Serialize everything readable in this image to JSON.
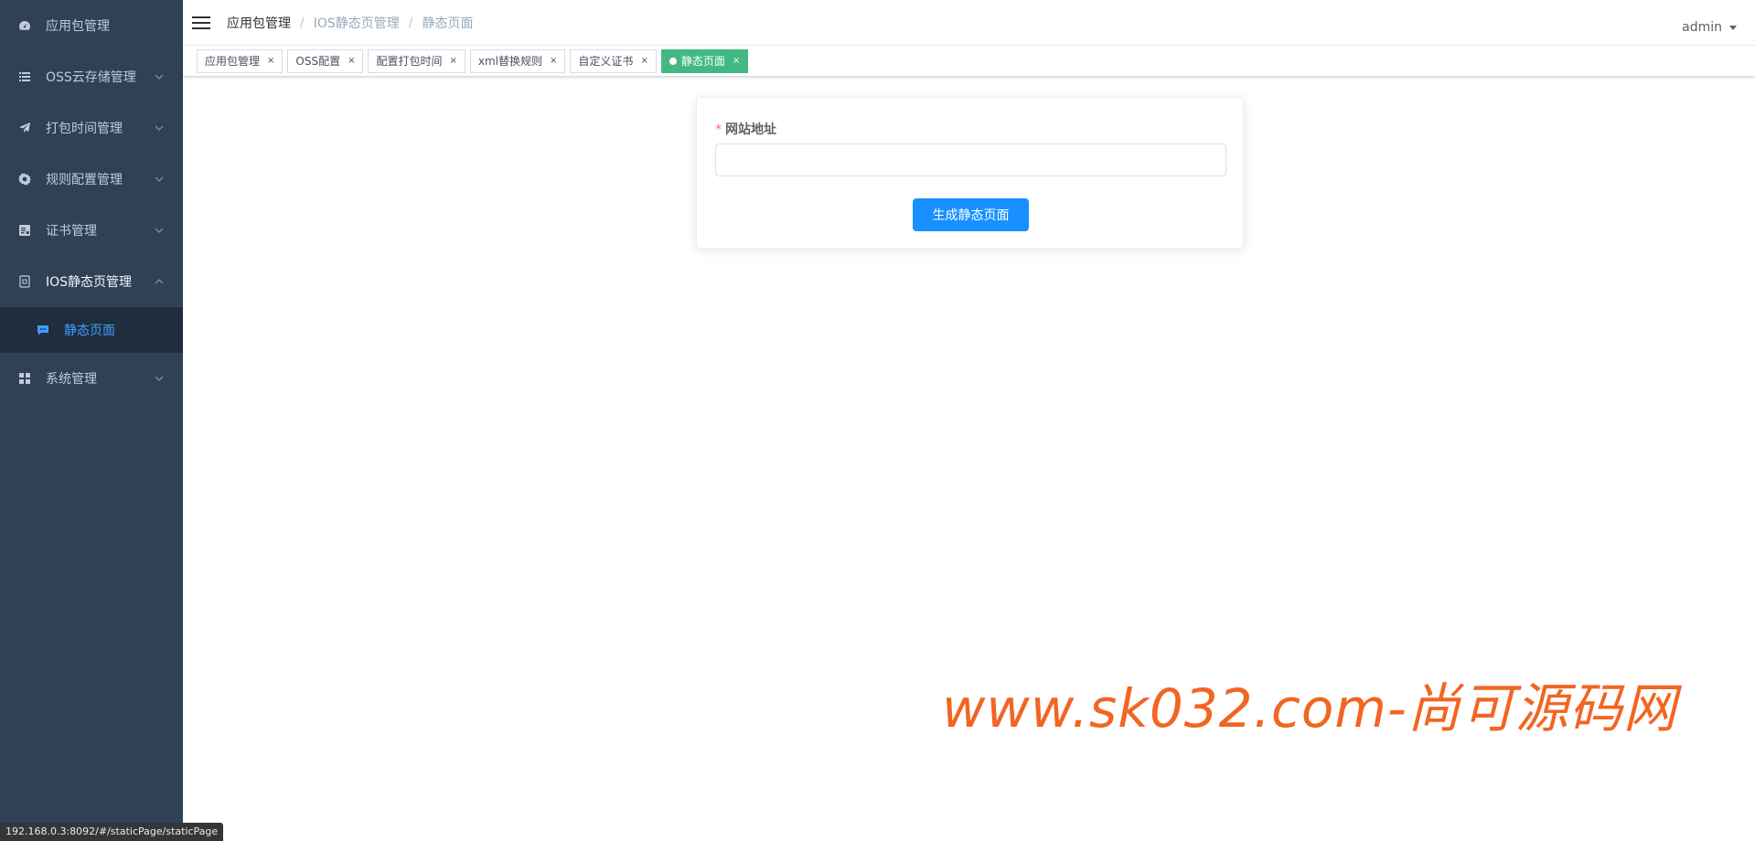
{
  "sidebar": {
    "items": [
      {
        "label": "应用包管理",
        "icon": "dashboard-icon"
      },
      {
        "label": "OSS云存储管理",
        "icon": "list-icon"
      },
      {
        "label": "打包时间管理",
        "icon": "paper-plane-icon"
      },
      {
        "label": "规则配置管理",
        "icon": "gear-icon"
      },
      {
        "label": "证书管理",
        "icon": "certificate-icon"
      },
      {
        "label": "IOS静态页管理",
        "icon": "page-icon"
      },
      {
        "label": "静态页面",
        "icon": "chat-icon"
      },
      {
        "label": "系统管理",
        "icon": "grid-icon"
      }
    ]
  },
  "breadcrumb": [
    "应用包管理",
    "IOS静态页管理",
    "静态页面"
  ],
  "user": {
    "name": "admin"
  },
  "tags": [
    {
      "label": "应用包管理"
    },
    {
      "label": "OSS配置"
    },
    {
      "label": "配置打包时间"
    },
    {
      "label": "xml替换规则"
    },
    {
      "label": "自定义证书"
    },
    {
      "label": "静态页面"
    }
  ],
  "form": {
    "label": "网站地址",
    "required_mark": "*",
    "value": "",
    "button": "生成静态页面"
  },
  "watermark": "www.sk032.com-尚可源码网",
  "status_url": "192.168.0.3:8092/#/staticPage/staticPage",
  "colors": {
    "sidebar_bg": "#304156",
    "active_tag": "#42b983",
    "primary": "#1890ff",
    "watermark": "#f26522"
  }
}
